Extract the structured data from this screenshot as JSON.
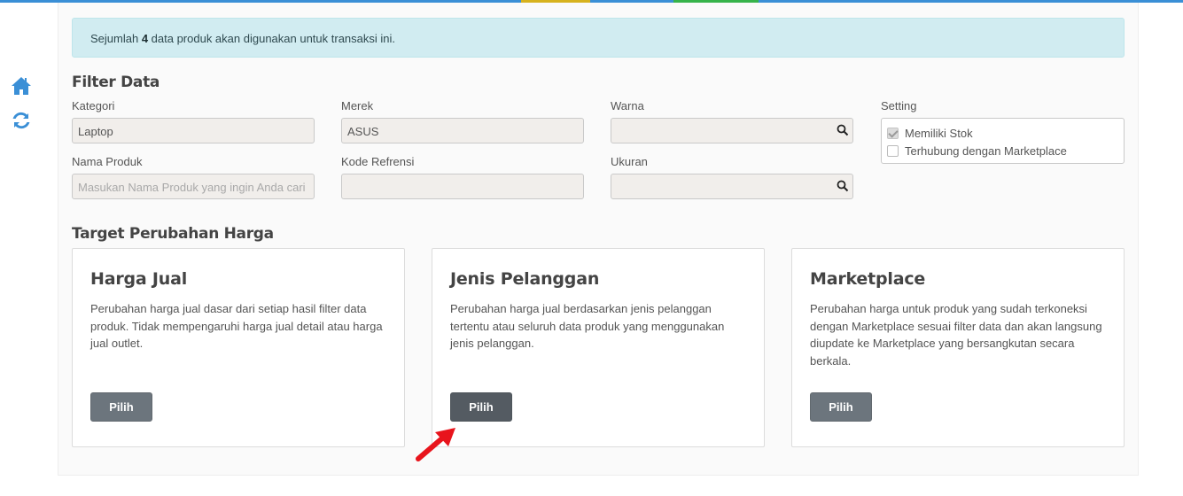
{
  "alert": {
    "prefix": "Sejumlah ",
    "count": "4",
    "suffix": " data produk akan digunakan untuk transaksi ini."
  },
  "filter": {
    "title": "Filter Data",
    "kategori": {
      "label": "Kategori",
      "value": "Laptop"
    },
    "merek": {
      "label": "Merek",
      "value": "ASUS"
    },
    "warna": {
      "label": "Warna",
      "value": ""
    },
    "setting": {
      "label": "Setting",
      "options": [
        {
          "label": "Memiliki Stok",
          "checked": true
        },
        {
          "label": "Terhubung dengan Marketplace",
          "checked": false
        }
      ]
    },
    "nama_produk": {
      "label": "Nama Produk",
      "placeholder": "Masukan Nama Produk yang ingin Anda cari"
    },
    "kode_refrensi": {
      "label": "Kode Refrensi",
      "value": ""
    },
    "ukuran": {
      "label": "Ukuran",
      "value": ""
    }
  },
  "target": {
    "title": "Target Perubahan Harga",
    "cards": [
      {
        "title": "Harga Jual",
        "description": "Perubahan harga jual dasar dari setiap hasil filter data produk. Tidak mempengaruhi harga jual detail atau harga jual outlet.",
        "button": "Pilih"
      },
      {
        "title": "Jenis Pelanggan",
        "description": "Perubahan harga jual berdasarkan jenis pelanggan tertentu atau seluruh data produk yang menggunakan jenis pelanggan.",
        "button": "Pilih"
      },
      {
        "title": "Marketplace",
        "description": "Perubahan harga untuk produk yang sudah terkoneksi dengan Marketplace sesuai filter data dan akan langsung diupdate ke Marketplace yang bersangkutan secara berkala.",
        "button": "Pilih"
      }
    ]
  },
  "colors": {
    "accent": "#3a8fd6",
    "button": "#6c757d",
    "alert_bg": "#d1ecf1",
    "arrow": "#e8141c"
  },
  "icons": {
    "side": [
      "home-icon",
      "refresh-icon"
    ],
    "search": "search-icon",
    "pointer": "arrow-pointer-icon"
  }
}
